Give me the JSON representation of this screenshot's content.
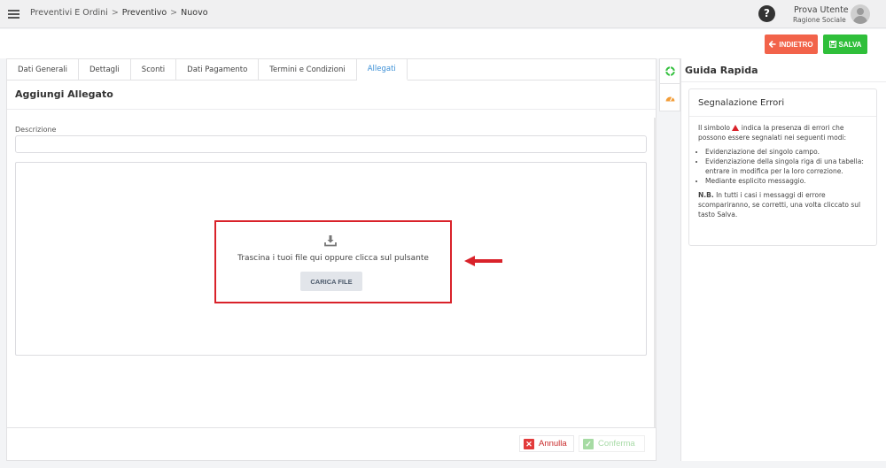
{
  "header": {
    "breadcrumb": [
      "Preventivi E Ordini",
      "Preventivo",
      "Nuovo"
    ],
    "breadcrumb_sep": ">",
    "help_symbol": "?",
    "user_name": "Prova Utente",
    "user_company": "Ragione Sociale"
  },
  "toolbar": {
    "back_label": "INDIETRO",
    "save_label": "SALVA"
  },
  "tabs": [
    "Dati Generali",
    "Dettagli",
    "Sconti",
    "Dati Pagamento",
    "Termini e Condizioni",
    "Allegati"
  ],
  "active_tab": "Allegati",
  "form": {
    "title": "Aggiungi Allegato",
    "description_label": "Descrizione",
    "description_value": "",
    "drop_text": "Trascina i tuoi file qui oppure clicca sul pulsante",
    "upload_label": "CARICA FILE"
  },
  "footer": {
    "cancel_label": "Annulla",
    "confirm_label": "Conferma"
  },
  "guide": {
    "title": "Guida Rapida",
    "card_title": "Segnalazione Errori",
    "intro_before": "Il simbolo",
    "intro_after": "indica la presenza di errori che possono essere segnalati nei seguenti modi:",
    "bullets": [
      "Evidenziazione del singolo campo.",
      "Evidenziazione della singola riga di una tabella: entrare in modifica per la loro correzione.",
      "Mediante esplicito messaggio."
    ],
    "note_bold": "N.B.",
    "note_text": "In tutti i casi i messaggi di errore scompariranno, se corretti, una volta cliccato sul tasto Salva."
  },
  "colors": {
    "back_button": "#f2634a",
    "save_button": "#2fbf3a",
    "active_tab": "#3b8fd6",
    "highlight_border": "#d9222a",
    "cancel": "#e23a3a",
    "confirm": "#a6dba3"
  },
  "icons": {
    "menu": "hamburger-icon",
    "help": "question-circle-icon",
    "avatar": "user-avatar-icon",
    "back": "arrow-left-icon",
    "save": "floppy-disk-icon",
    "upload": "download-tray-icon",
    "pointer": "red-arrow-left-icon",
    "cancel": "close-icon",
    "confirm": "check-icon",
    "side_tab_1": "life-ring-icon",
    "side_tab_2": "gauge-icon",
    "warning": "warning-triangle-icon"
  }
}
